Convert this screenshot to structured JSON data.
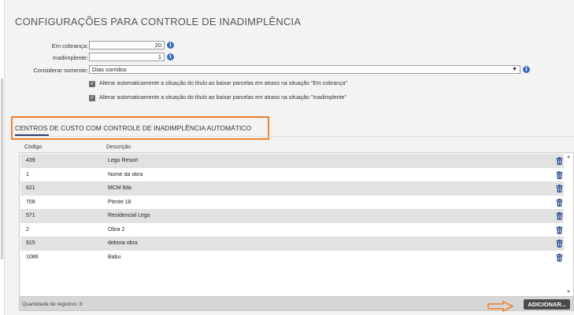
{
  "page": {
    "title": "CONFIGURAÇÕES PARA CONTROLE DE INADIMPLÊNCIA"
  },
  "settings": {
    "em_cobranca_label": "Em cobrança:",
    "em_cobranca_value": "20",
    "inadimplente_label": "Inadimplente:",
    "inadimplente_value": "1",
    "considerar_label": "Considerar somente:",
    "considerar_value": "Dias corridos",
    "info_glyph": "i",
    "check_glyph": "✓",
    "checkbox1_label": "Alterar automaticamente a situação do título ao baixar parcelas em atraso na situação \"Em cobrança\"",
    "checkbox2_label": "Alterar automaticamente a situação do título ao baixar parcelas em atraso na situação \"Inadimplente\""
  },
  "section": {
    "title": "CENTROS DE CUSTO COM CONTROLE DE INADIMPLÊNCIA AUTOMÁTICO"
  },
  "table": {
    "headers": [
      "Código",
      "Descrição"
    ],
    "rows": [
      {
        "codigo": "439",
        "descricao": "Lego Resort"
      },
      {
        "codigo": "1",
        "descricao": "Nome da obra"
      },
      {
        "codigo": "621",
        "descricao": "MCM ltda"
      },
      {
        "codigo": "708",
        "descricao": "Pteste 18"
      },
      {
        "codigo": "571",
        "descricao": "Residencial Lego"
      },
      {
        "codigo": "2",
        "descricao": "Obra 2"
      },
      {
        "codigo": "915",
        "descricao": "debora obra"
      },
      {
        "codigo": "1086",
        "descricao": "Babu"
      }
    ]
  },
  "footer": {
    "count_label": "Quantidade de registros: 8",
    "add_button": "ADICIONAR..."
  },
  "colors": {
    "accent_orange": "#f07f2a",
    "info_blue": "#3a6fb8",
    "trash_blue": "#2e4f8f",
    "section_underline": "#2b3d73"
  }
}
